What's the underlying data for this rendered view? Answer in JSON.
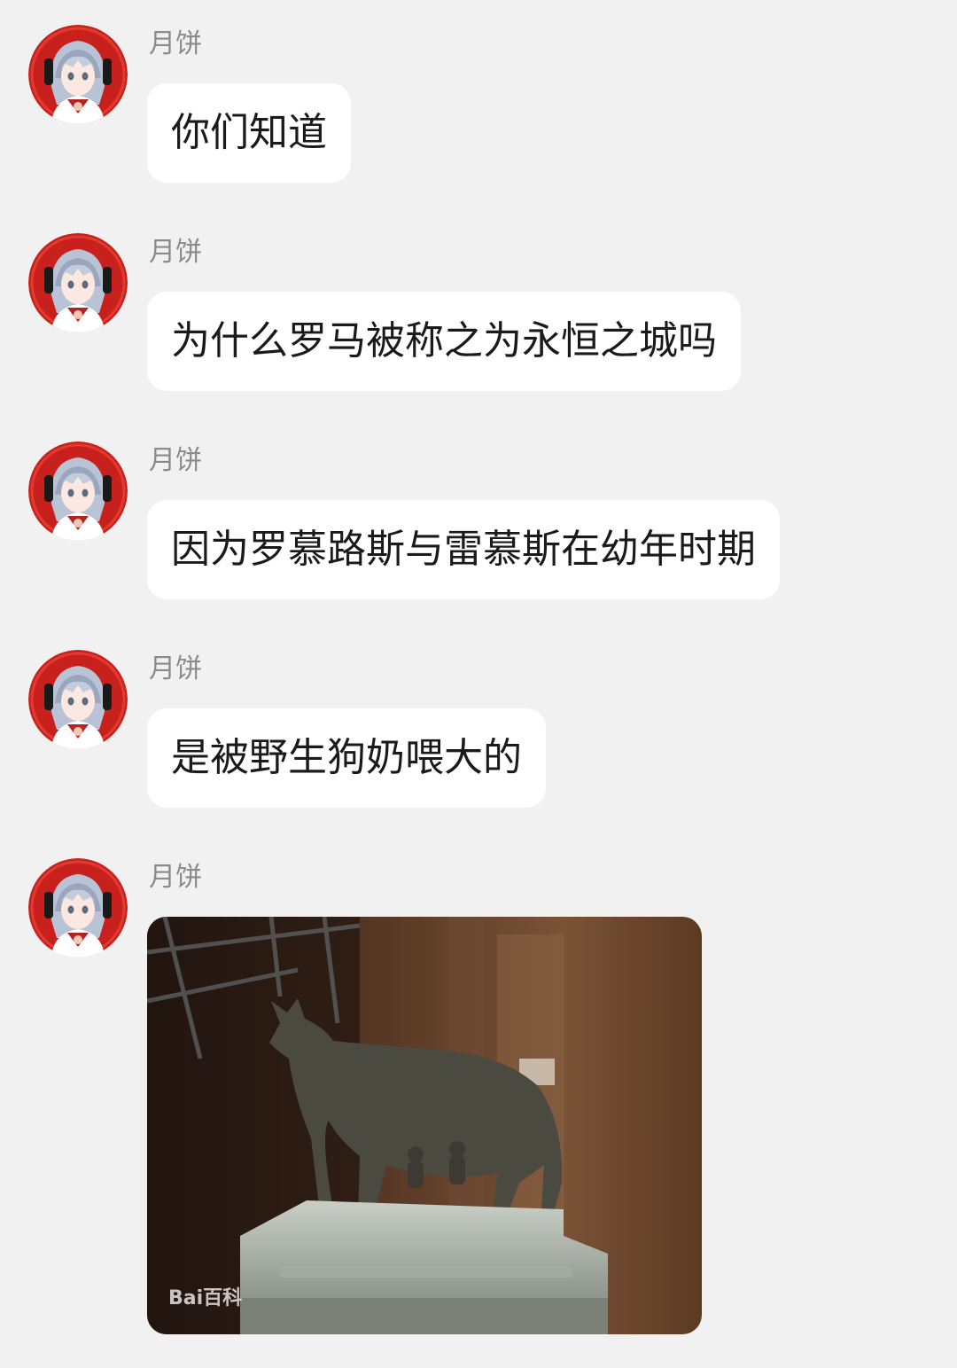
{
  "sender_name": "月饼",
  "messages": [
    {
      "text": "你们知道"
    },
    {
      "text": "为什么罗马被称之为永恒之城吗"
    },
    {
      "text": "因为罗慕路斯与雷慕斯在幼年时期"
    },
    {
      "text": "是被野生狗奶喂大的"
    }
  ],
  "image_message": {
    "watermark": "Bai百科"
  }
}
